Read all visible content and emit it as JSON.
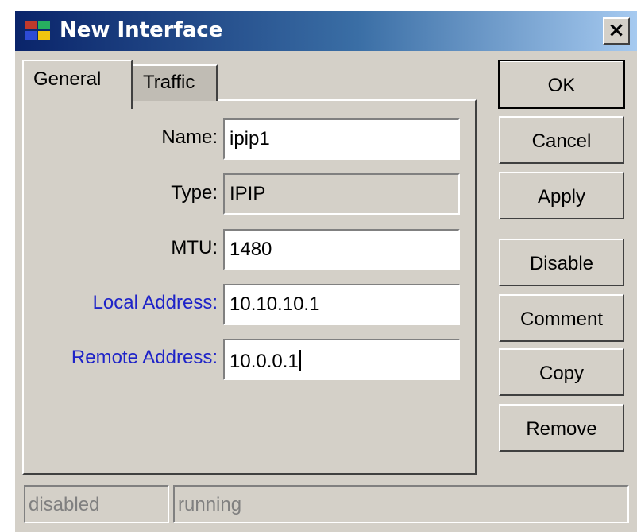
{
  "window": {
    "title": "New Interface",
    "close_glyph": "×",
    "title_gradient": [
      "#0a246a",
      "#a6caf0"
    ]
  },
  "tabs": [
    {
      "label": "General",
      "active": true
    },
    {
      "label": "Traffic",
      "active": false
    }
  ],
  "form": {
    "name": {
      "label": "Name:",
      "value": "ipip1"
    },
    "type": {
      "label": "Type:",
      "value": "IPIP"
    },
    "mtu": {
      "label": "MTU:",
      "value": "1480"
    },
    "local_address": {
      "label": "Local Address:",
      "value": "10.10.10.1",
      "label_color": "#1e23c8"
    },
    "remote_address": {
      "label": "Remote Address:",
      "value": "10.0.0.1",
      "label_color": "#1e23c8"
    }
  },
  "buttons": {
    "ok": "OK",
    "cancel": "Cancel",
    "apply": "Apply",
    "disable": "Disable",
    "comment": "Comment",
    "copy": "Copy",
    "remove": "Remove"
  },
  "status": {
    "disabled": "disabled",
    "running": "running"
  },
  "colors": {
    "dialog_face": "#d4d0c8",
    "link_label": "#1e23c8"
  },
  "icons": {
    "app": "winbox-app-icon",
    "close": "close-icon"
  }
}
